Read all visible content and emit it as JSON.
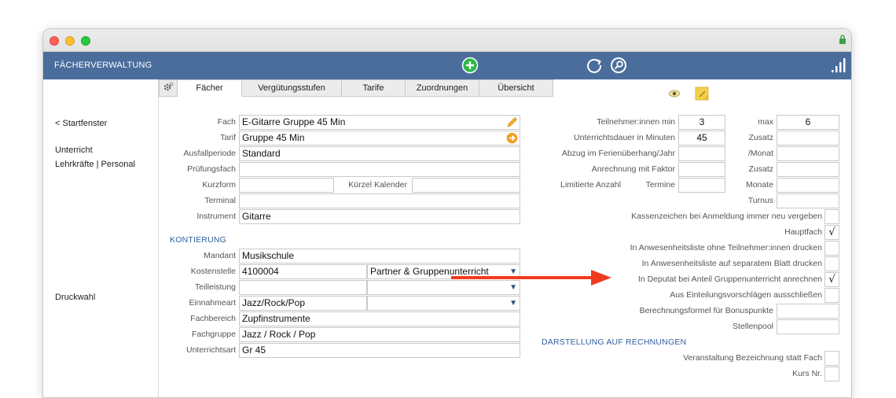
{
  "app": {
    "title": "FÄCHERVERWALTUNG"
  },
  "sidebar": {
    "back": "< Startfenster",
    "items": [
      "Unterricht",
      "Lehrkräfte | Personal"
    ],
    "print": "Druckwahl"
  },
  "tabs": [
    "Fächer",
    "Vergütungsstufen",
    "Tarife",
    "Zuordnungen",
    "Übersicht"
  ],
  "left": {
    "fach_label": "Fach",
    "fach_value": "E-Gitarre Gruppe 45 Min",
    "tarif_label": "Tarif",
    "tarif_value": "Gruppe 45 Min",
    "ausfall_label": "Ausfallperiode",
    "ausfall_value": "Standard",
    "pruefung_label": "Prüfungsfach",
    "pruefung_value": "",
    "kurzform_label": "Kurzform",
    "kurzform_value": "",
    "kuerzel_label": "Kürzel Kalender",
    "kuerzel_value": "",
    "terminal_label": "Terminal",
    "terminal_value": "",
    "instrument_label": "Instrument",
    "instrument_value": "Gitarre",
    "section_kontierung": "KONTIERUNG",
    "mandant_label": "Mandant",
    "mandant_value": "Musikschule",
    "kostenstelle_label": "Kostenstelle",
    "kostenstelle_value": "4100004",
    "kostenstelle_select": "Partner & Gruppenunterricht",
    "teilleistung_label": "Teilleistung",
    "teilleistung_value": "",
    "teilleistung_select": "",
    "einnahmeart_label": "Einnahmeart",
    "einnahmeart_value": "Jazz/Rock/Pop",
    "einnahmeart_select": "",
    "fachbereich_label": "Fachbereich",
    "fachbereich_value": "Zupfinstrumente",
    "fachgruppe_label": "Fachgruppe",
    "fachgruppe_value": "Jazz / Rock / Pop",
    "unterrichtsart_label": "Unterrichtsart",
    "unterrichtsart_value": "Gr 45"
  },
  "right": {
    "teilnehmer_min_label": "Teilnehmer:innen min",
    "teilnehmer_min_value": "3",
    "max_label": "max",
    "max_value": "6",
    "dauer_label": "Unterrichtsdauer in Minuten",
    "dauer_value": "45",
    "zusatz_label": "Zusatz",
    "zusatz_value": "",
    "abzug_label": "Abzug im Ferienüberhang/Jahr",
    "abzug_value": "",
    "monat_label": "/Monat",
    "monat_value": "",
    "anrechnung_label": "Anrechnung mit Faktor",
    "anrechnung_value": "",
    "zusatz2_label": "Zusatz",
    "zusatz2_value": "",
    "limitierte_label": "Limitierte Anzahl",
    "termine_label": "Termine",
    "termine_value": "",
    "monate_label": "Monate",
    "monate_value": "",
    "turnus_label": "Turnus",
    "turnus_value": "",
    "kassenzeichen_label": "Kassenzeichen bei Anmeldung immer neu vergeben",
    "kassenzeichen_checked": "",
    "hauptfach_label": "Hauptfach",
    "hauptfach_checked": "√",
    "anwesenheit1_label": "In Anwesenheitsliste ohne Teilnehmer:innen drucken",
    "anwesenheit1_checked": "",
    "anwesenheit2_label": "In Anwesenheitsliste auf separatem Blatt drucken",
    "anwesenheit2_checked": "",
    "deputat_label": "In Deputat bei Anteil Gruppenunterricht anrechnen",
    "deputat_checked": "√",
    "einteilung_label": "Aus Einteilungsvorschlägen ausschließen",
    "einteilung_checked": "",
    "bonus_label": "Berechnungsformel für Bonuspunkte",
    "bonus_value": "",
    "stellenpool_label": "Stellenpool",
    "stellenpool_value": "",
    "section_rechnungen": "DARSTELLUNG AUF RECHNUNGEN",
    "veranstaltung_label": "Veranstaltung Bezeichnung statt Fach",
    "veranstaltung_checked": "",
    "kurs_label": "Kurs Nr.",
    "kurs_checked": ""
  },
  "colors": {
    "appbar": "#4a6d9c",
    "section": "#2f5f9e",
    "arrow": "#f03a1f"
  }
}
